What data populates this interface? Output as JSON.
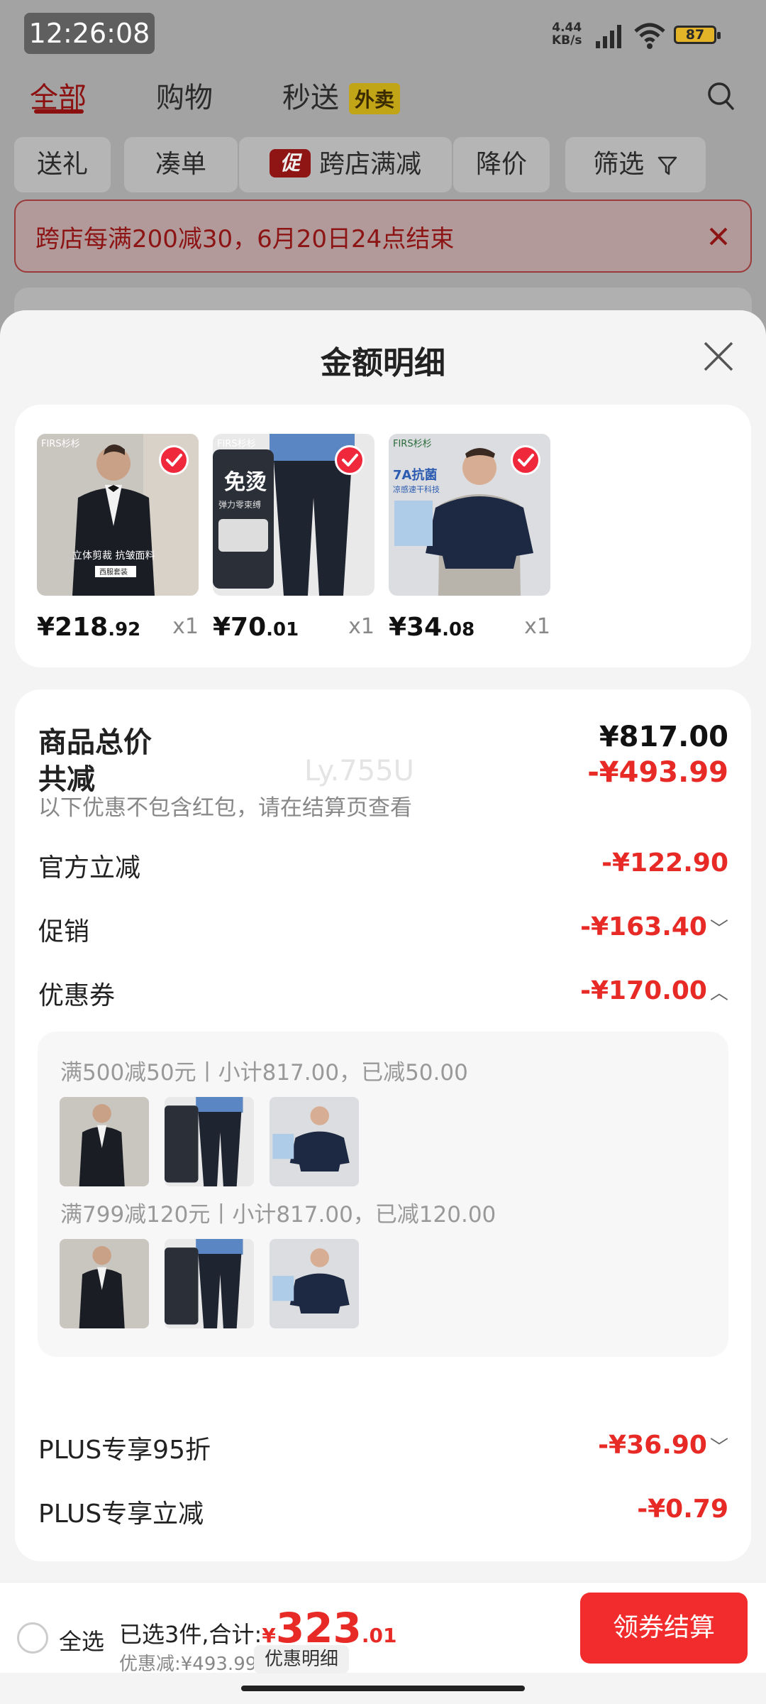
{
  "status_bar": {
    "time": "12:26:08",
    "net_speed_value": "4.44",
    "net_speed_unit": "KB/s",
    "battery": "87"
  },
  "tabs": [
    {
      "label": "全部"
    },
    {
      "label": "购物"
    },
    {
      "label": "秒送"
    }
  ],
  "waimai_badge": "外卖",
  "filters": {
    "gift": "送礼",
    "combine": "凑单",
    "promo_badge": "促",
    "cross_store": "跨店满减",
    "price_drop": "降价",
    "filter": "筛选"
  },
  "promo_banner": "跨店每满200减30，6月20日24点结束",
  "sheet": {
    "title": "金额明细",
    "items": [
      {
        "price_int": "¥218",
        "price_dec": ".92",
        "qty": "x1"
      },
      {
        "price_int": "¥70",
        "price_dec": ".01",
        "qty": "x1"
      },
      {
        "price_int": "¥34",
        "price_dec": ".08",
        "qty": "x1"
      }
    ],
    "thumb_texts": {
      "brand": "FIRS杉杉",
      "suit_caption": "立体剪裁 抗皱面料",
      "suit_tag": "西服套装",
      "pants_title": "免烫",
      "pants_sub": "弹力零束缚",
      "tee_title": "7A抗菌",
      "tee_sub": "凉感速干科技"
    },
    "total_label": "商品总价",
    "total_value": "¥817.00",
    "reduce_label": "共减",
    "reduce_value": "-¥493.99",
    "reduce_note": "以下优惠不包含红包，请在结算页查看",
    "watermark": "Ly.755U",
    "official_label": "官方立减",
    "official_value": "-¥122.90",
    "promo_label": "促销",
    "promo_value": "-¥163.40",
    "coupon_label": "优惠券",
    "coupon_value": "-¥170.00",
    "coupons": [
      {
        "text": "满500减50元丨小计817.00，已减50.00"
      },
      {
        "text": "满799减120元丨小计817.00，已减120.00"
      }
    ],
    "plus95_label": "PLUS专享95折",
    "plus95_value": "-¥36.90",
    "plus_cut_label": "PLUS专享立减",
    "plus_cut_value": "-¥0.79"
  },
  "bottom": {
    "select_all": "全选",
    "selected_text": "已选3件,合计:",
    "currency": "¥",
    "amount_int": "323",
    "amount_dec": ".01",
    "discount_text": "优惠减:¥493.99",
    "detail_button": "优惠明细",
    "checkout": "领券结算"
  },
  "colors": {
    "accent_red": "#e82a26",
    "checkout_red": "#f22c2c"
  }
}
